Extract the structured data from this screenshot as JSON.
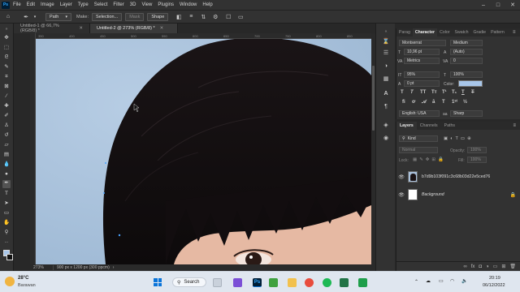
{
  "menubar": {
    "logo": "Ps",
    "items": [
      "File",
      "Edit",
      "Image",
      "Layer",
      "Type",
      "Select",
      "Filter",
      "3D",
      "View",
      "Plugins",
      "Window",
      "Help"
    ]
  },
  "options": {
    "mode": "Path",
    "make_label": "Make:",
    "selection_btn": "Selection...",
    "mask_btn": "Mask",
    "shape_btn": "Shape"
  },
  "tabs": [
    {
      "label": "Untitled-1 @ 66,7% (RGB/8) *",
      "active": false
    },
    {
      "label": "Untitled-2 @ 273% (RGB/8) *",
      "active": true
    }
  ],
  "ruler": {
    "top_ticks": [
      "350",
      "400",
      "450",
      "500",
      "550",
      "600",
      "650",
      "700",
      "750",
      "800",
      "850"
    ]
  },
  "status": {
    "zoom": "273%",
    "doc": "900 px x 1200 px (300 ppcm)"
  },
  "character": {
    "tabs": [
      "Parag",
      "Character",
      "Color",
      "Swatch",
      "Gradie",
      "Pattern"
    ],
    "font": "Montserrat",
    "style": "Medium",
    "size": "10,96 pt",
    "leading": "(Auto)",
    "kerning": "Metrics",
    "tracking": "0",
    "vscale": "95%",
    "hscale": "100%",
    "baseline": "0 pt",
    "color_label": "Color:",
    "language": "English: USA",
    "antialias": "Sharp",
    "swatch_color": "#a9c7ea"
  },
  "layers": {
    "tabs": [
      "Layers",
      "Channels",
      "Paths"
    ],
    "filter": "Kind",
    "blend": "Normal",
    "opacity_label": "Opacity:",
    "opacity": "100%",
    "lock_label": "Lock:",
    "fill_label": "Fill:",
    "fill": "100%",
    "items": [
      {
        "name": "b7d9b103f091c3c68b03d22e5ced76",
        "selected": false
      },
      {
        "name": "Background",
        "selected": false
      }
    ]
  },
  "taskbar": {
    "temp": "28°C",
    "location": "Barawan",
    "search": "Search",
    "time": "20:19",
    "date": "06/12/2022"
  }
}
